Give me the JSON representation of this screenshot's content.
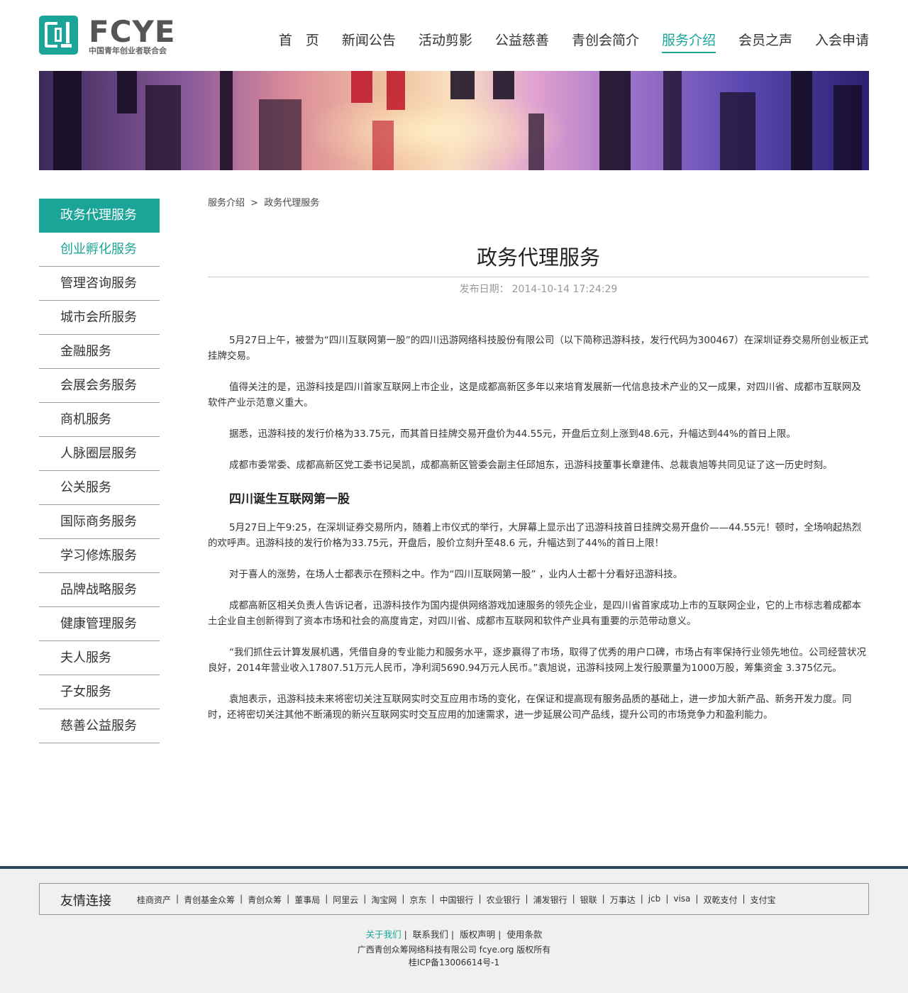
{
  "header": {
    "logo_text": "FCYE",
    "logo_subtitle": "中国青年创业者联合会",
    "nav": [
      {
        "label": "首　页"
      },
      {
        "label": "新闻公告"
      },
      {
        "label": "活动剪影"
      },
      {
        "label": "公益慈善"
      },
      {
        "label": "青创会简介"
      },
      {
        "label": "服务介绍",
        "active": true
      },
      {
        "label": "会员之声"
      },
      {
        "label": "入会申请"
      }
    ]
  },
  "sidebar": {
    "items": [
      {
        "label": "政务代理服务"
      },
      {
        "label": "创业孵化服务"
      },
      {
        "label": "管理咨询服务"
      },
      {
        "label": "城市会所服务"
      },
      {
        "label": "金融服务"
      },
      {
        "label": "会展会务服务"
      },
      {
        "label": "商机服务"
      },
      {
        "label": "人脉圈层服务"
      },
      {
        "label": "公关服务"
      },
      {
        "label": "国际商务服务"
      },
      {
        "label": "学习修炼服务"
      },
      {
        "label": "品牌战略服务"
      },
      {
        "label": "健康管理服务"
      },
      {
        "label": "夫人服务"
      },
      {
        "label": "子女服务"
      },
      {
        "label": "慈善公益服务"
      }
    ]
  },
  "breadcrumb": {
    "parent": "服务介绍",
    "separator": ">",
    "current": "政务代理服务"
  },
  "article": {
    "title": "政务代理服务",
    "date_label": "发布日期：",
    "date_value": "2014-10-14 17:24:29",
    "paragraphs": [
      "5月27日上午，被誉为“四川互联网第一股”的四川迅游网络科技股份有限公司（以下简称迅游科技，发行代码为300467）在深圳证券交易所创业板正式挂牌交易。",
      "值得关注的是，迅游科技是四川首家互联网上市企业，这是成都高新区多年以来培育发展新一代信息技术产业的又一成果，对四川省、成都市互联网及软件产业示范意义重大。",
      "据悉，迅游科技的发行价格为33.75元，而其首日挂牌交易开盘价为44.55元，开盘后立刻上涨到48.6元，升幅达到44%的首日上限。",
      "成都市委常委、成都高新区党工委书记吴凯，成都高新区管委会副主任邱旭东，迅游科技董事长章建伟、总裁袁旭等共同见证了这一历史时刻。"
    ],
    "subheading": "四川诞生互联网第一股",
    "paragraphs2": [
      "5月27日上午9:25，在深圳证券交易所内，随着上市仪式的举行，大屏幕上显示出了迅游科技首日挂牌交易开盘价——44.55元！顿时，全场响起热烈的欢呼声。迅游科技的发行价格为33.75元，开盘后，股价立刻升至48.6 元，升幅达到了44%的首日上限！",
      "对于喜人的涨势，在场人士都表示在预料之中。作为“四川互联网第一股” ，业内人士都十分看好迅游科技。",
      "成都高新区相关负责人告诉记者，迅游科技作为国内提供网络游戏加速服务的领先企业，是四川省首家成功上市的互联网企业，它的上市标志着成都本土企业自主创新得到了资本市场和社会的高度肯定，对四川省、成都市互联网和软件产业具有重要的示范带动意义。",
      "“我们抓住云计算发展机遇，凭借自身的专业能力和服务水平，逐步赢得了市场，取得了优秀的用户口碑，市场占有率保持行业领先地位。公司经营状况良好，2014年营业收入17807.51万元人民币，净利润5690.94万元人民币。”袁旭说，迅游科技网上发行股票量为1000万股，筹集资金 3.375亿元。",
      "袁旭表示，迅游科技未来将密切关注互联网实时交互应用市场的变化，在保证和提高现有服务品质的基础上，进一步加大新产品、新务开发力度。同时，还将密切关注其他不断涌现的新兴互联网实时交互应用的加速需求，进一步延展公司产品线，提升公司的市场竞争力和盈利能力。"
    ]
  },
  "footer": {
    "links_title": "友情连接",
    "links": [
      "桂商资产",
      "青创基金众筹",
      "青创众筹",
      "董事局",
      "阿里云",
      "淘宝网",
      "京东",
      "中国银行",
      "农业银行",
      "浦发银行",
      "银联",
      "万事达",
      "jcb",
      "visa",
      "双乾支付",
      "支付宝"
    ],
    "bottom_links": [
      "关于我们",
      "联系我们",
      "版权声明",
      "使用条款"
    ],
    "company": "广西青创众筹网络科技有限公司 fcye.org 版权所有",
    "icp": "桂ICP备13006614号-1"
  },
  "colors": {
    "accent": "#1aa598",
    "footer_bar": "#2f4858"
  }
}
